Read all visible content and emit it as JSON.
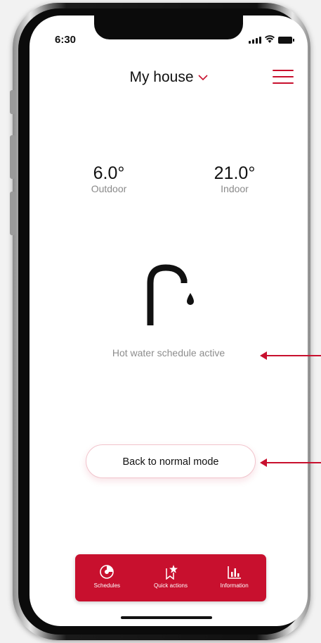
{
  "status_bar": {
    "time": "6:30"
  },
  "header": {
    "title": "My house"
  },
  "temperatures": {
    "outdoor": {
      "value": "6.0°",
      "label": "Outdoor"
    },
    "indoor": {
      "value": "21.0°",
      "label": "Indoor"
    }
  },
  "status": {
    "text": "Hot water schedule active"
  },
  "actions": {
    "back_label": "Back to normal mode"
  },
  "tabbar": {
    "items": [
      {
        "label": "Schedules",
        "icon": "schedule-icon"
      },
      {
        "label": "Quick actions",
        "icon": "quick-actions-icon"
      },
      {
        "label": "Information",
        "icon": "information-icon"
      }
    ]
  },
  "colors": {
    "accent": "#c8102e",
    "text": "#111111",
    "muted": "#8d8d8d",
    "background": "#ffffff"
  }
}
